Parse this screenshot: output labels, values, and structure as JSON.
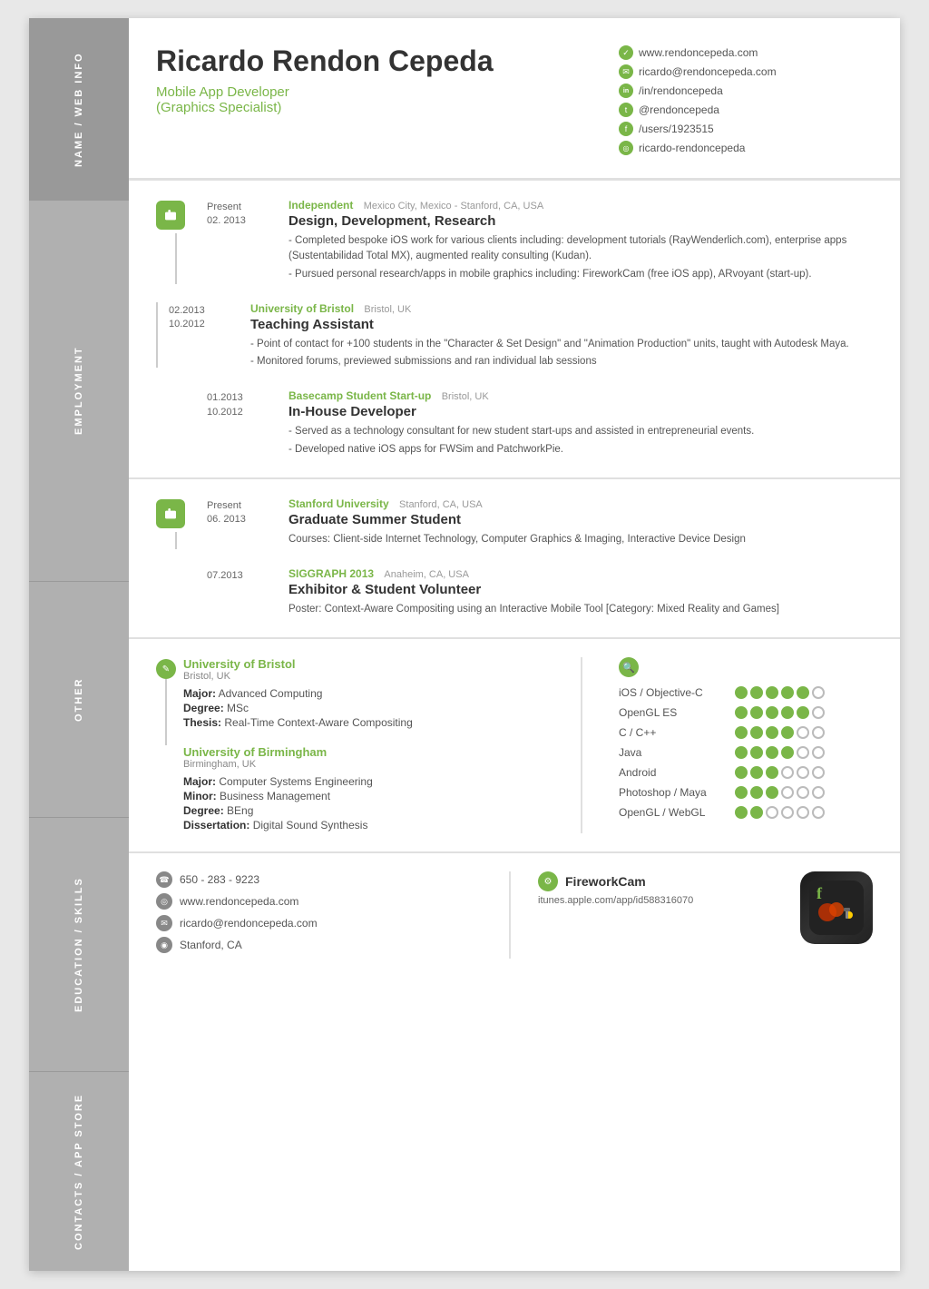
{
  "header": {
    "name": "Ricardo Rendon Cepeda",
    "title": "Mobile App Developer",
    "subtitle": "(Graphics Specialist)",
    "contacts": [
      {
        "icon": "✓",
        "text": "www.rendoncepeda.com"
      },
      {
        "icon": "✉",
        "text": "ricardo@rendoncepeda.com"
      },
      {
        "icon": "in",
        "text": "/in/rendoncepeda"
      },
      {
        "icon": "t",
        "text": "@rendoncepeda"
      },
      {
        "icon": "f",
        "text": "/users/1923515"
      },
      {
        "icon": "g",
        "text": "ricardo-rendoncepeda"
      }
    ]
  },
  "sidebar": {
    "sections": [
      "NAME / WEB INFO",
      "EMPLOYMENT",
      "OTHER",
      "EDUCATION / SKILLS",
      "CONTACTS / APP STORE"
    ]
  },
  "employment": [
    {
      "dateStart": "Present",
      "dateEnd": "02. 2013",
      "company": "Independent",
      "location": "Mexico City, Mexico - Stanford, CA, USA",
      "title": "Design, Development, Research",
      "descriptions": [
        "- Completed bespoke iOS work for various clients including: development tutorials (RayWenderlich.com), enterprise apps (Sustentabilidad Total MX), augmented reality consulting (Kudan).",
        "- Pursued personal research/apps in mobile graphics including: FireworkCam (free iOS app), ARvoyant (start-up)."
      ]
    },
    {
      "dateStart": "02.2013",
      "dateEnd": "10.2012",
      "company": "University of Bristol",
      "location": "Bristol, UK",
      "title": "Teaching Assistant",
      "descriptions": [
        "- Point of contact for +100 students in the \"Character & Set Design\" and \"Animation Production\" units, taught with Autodesk Maya.",
        "- Monitored forums, previewed submissions and ran individual lab sessions"
      ]
    },
    {
      "dateStart": "01.2013",
      "dateEnd": "10.2012",
      "company": "Basecamp Student Start-up",
      "location": "Bristol, UK",
      "title": "In-House Developer",
      "descriptions": [
        "- Served as a technology consultant for new student start-ups and assisted in entrepreneurial events.",
        "- Developed native iOS apps for FWSim and PatchworkPie."
      ]
    }
  ],
  "other": [
    {
      "dateStart": "Present",
      "dateEnd": "06. 2013",
      "company": "Stanford University",
      "location": "Stanford, CA, USA",
      "title": "Graduate Summer Student",
      "descriptions": [
        "Courses: Client-side Internet Technology, Computer Graphics & Imaging, Interactive Device Design"
      ]
    },
    {
      "dateStart": "07.2013",
      "dateEnd": "",
      "company": "SIGGRAPH 2013",
      "location": "Anaheim, CA, USA",
      "title": "Exhibitor & Student Volunteer",
      "descriptions": [
        "Poster: Context-Aware Compositing using an Interactive Mobile Tool [Category: Mixed Reality and Games]"
      ]
    }
  ],
  "education": [
    {
      "university": "University of Bristol",
      "location": "Bristol, UK",
      "major": "Advanced Computing",
      "degree": "MSc",
      "thesis": "Real-Time Context-Aware Compositing"
    },
    {
      "university": "University of Birmingham",
      "location": "Birmingham, UK",
      "major": "Computer Systems Engineering",
      "minor": "Business Management",
      "degree": "BEng",
      "dissertation": "Digital Sound Synthesis"
    }
  ],
  "skills": [
    {
      "name": "iOS / Objective-C",
      "filled": 5,
      "empty": 1
    },
    {
      "name": "OpenGL ES",
      "filled": 5,
      "empty": 1
    },
    {
      "name": "C / C++",
      "filled": 4,
      "empty": 2
    },
    {
      "name": "Java",
      "filled": 4,
      "empty": 2
    },
    {
      "name": "Android",
      "filled": 3,
      "empty": 3
    },
    {
      "name": "Photoshop / Maya",
      "filled": 3,
      "empty": 3
    },
    {
      "name": "OpenGL / WebGL",
      "filled": 2,
      "empty": 4
    }
  ],
  "contacts": {
    "phone": "650 - 283 - 9223",
    "website": "www.rendoncepeda.com",
    "email": "ricardo@rendoncepeda.com",
    "location": "Stanford, CA",
    "app_name": "FireworkCam",
    "app_url": "itunes.apple.com/app/id588316070"
  },
  "colors": {
    "green": "#7ab648",
    "sidebar": "#b0b0b0",
    "text_dark": "#333333",
    "text_mid": "#555555",
    "text_light": "#999999"
  }
}
